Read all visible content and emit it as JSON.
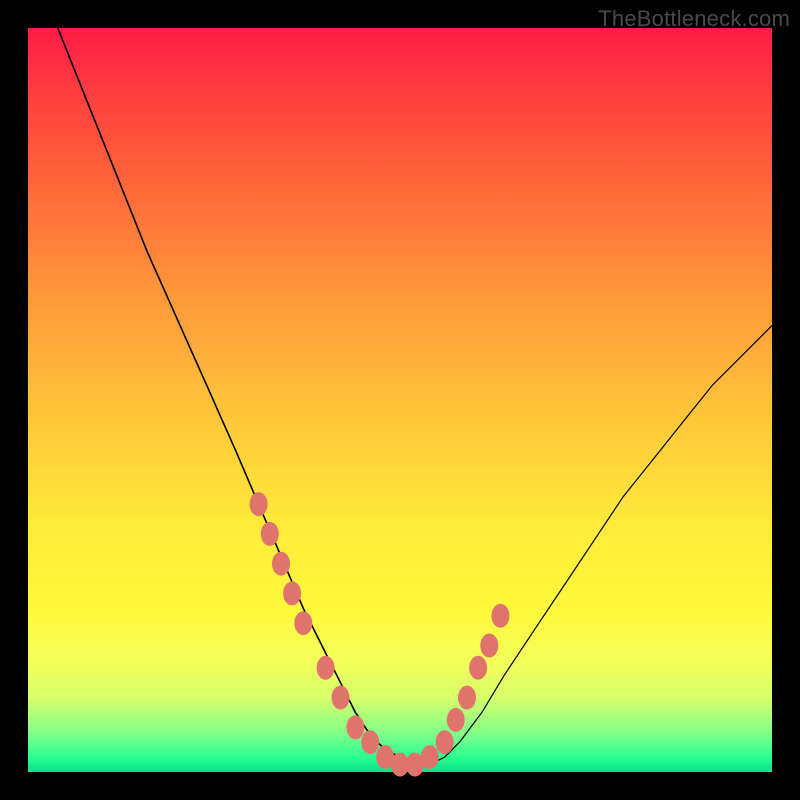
{
  "watermark": "TheBottleneck.com",
  "colors": {
    "dot": "#e0746d",
    "curve": "#000000",
    "frame_bg_top": "#ff1a47",
    "frame_bg_bottom": "#06e08a",
    "page_bg": "#000000"
  },
  "chart_data": {
    "type": "line",
    "title": "",
    "xlabel": "",
    "ylabel": "",
    "xlim": [
      0,
      100
    ],
    "ylim": [
      0,
      100
    ],
    "grid": false,
    "series": [
      {
        "name": "bottleneck-curve",
        "x": [
          4,
          8,
          12,
          16,
          20,
          24,
          28,
          31,
          34,
          37,
          40,
          42,
          44,
          46,
          48,
          50,
          52,
          54,
          56,
          58,
          61,
          64,
          68,
          72,
          76,
          80,
          84,
          88,
          92,
          96,
          100
        ],
        "y": [
          100,
          90,
          80,
          70,
          61,
          52,
          43,
          36,
          29,
          22,
          16,
          12,
          8,
          5,
          3,
          2,
          1,
          1,
          2,
          4,
          8,
          13,
          19,
          25,
          31,
          37,
          42,
          47,
          52,
          56,
          60
        ]
      }
    ],
    "highlight_points": {
      "name": "highlight-dots",
      "x": [
        31,
        32.5,
        34,
        35.5,
        37,
        40,
        42,
        44,
        46,
        48,
        50,
        52,
        54,
        56,
        57.5,
        59,
        60.5,
        62,
        63.5
      ],
      "y": [
        36,
        32,
        28,
        24,
        20,
        14,
        10,
        6,
        4,
        2,
        1,
        1,
        2,
        4,
        7,
        10,
        14,
        17,
        21
      ]
    }
  }
}
